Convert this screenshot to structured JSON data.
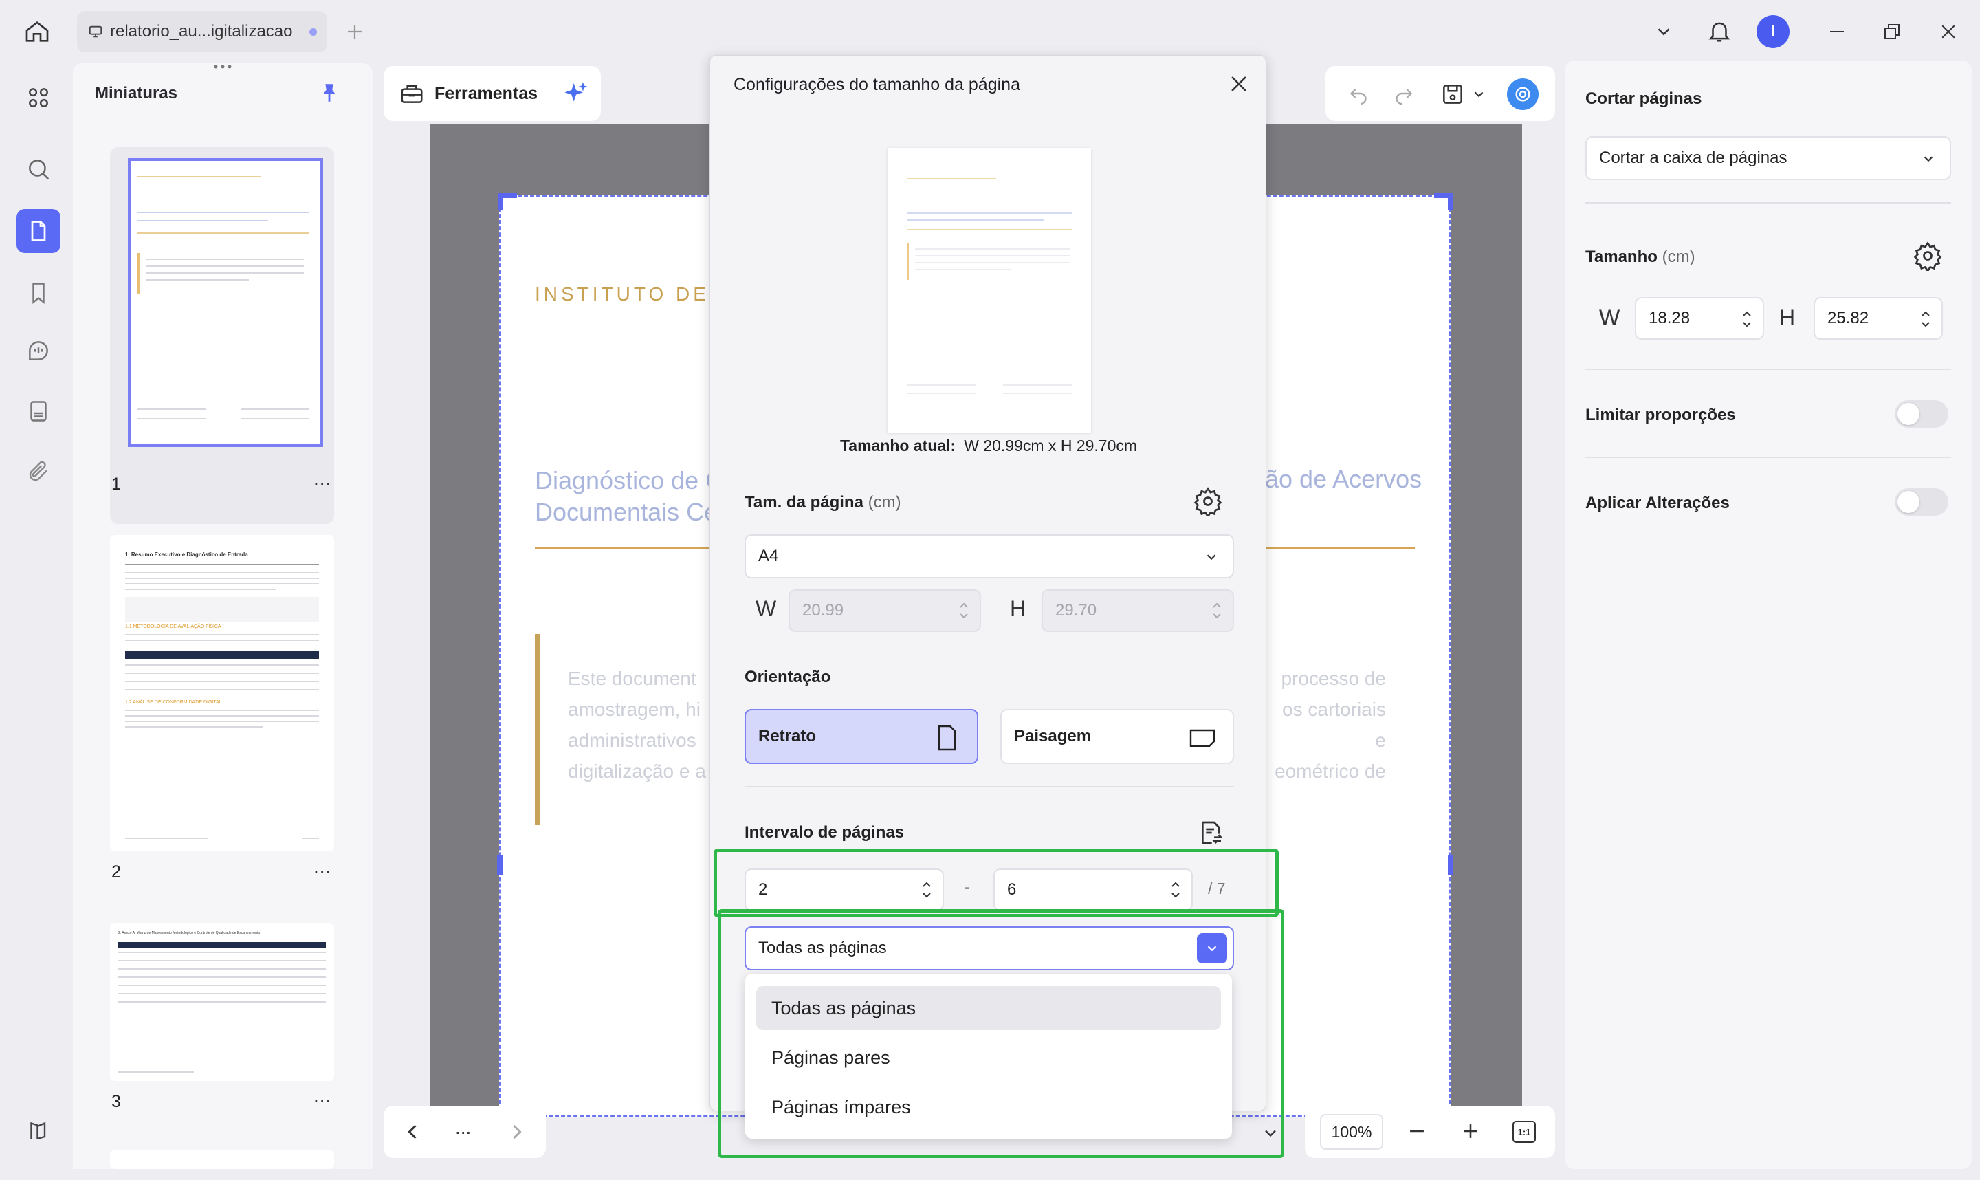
{
  "titlebar": {
    "tab_title": "relatorio_au...igitalizacao",
    "avatar_letter": "I"
  },
  "thumbnails": {
    "title": "Miniaturas",
    "pages": [
      "1",
      "2",
      "3"
    ],
    "more": "..."
  },
  "toolbar": {
    "tools_label": "Ferramentas"
  },
  "document": {
    "header": "INSTITUTO DE P",
    "title_left_1": "Diagnóstico de C",
    "title_left_2": "Documentais Ce",
    "title_right": "ão de Acervos",
    "body_left": [
      "Este document",
      "amostragem, hi",
      "administrativos",
      "digitalização e a"
    ],
    "body_right": [
      "processo de",
      "os cartoriais e",
      "eométrico de"
    ]
  },
  "thumb2": {
    "heading": "1. Resumo Executivo e Diagnóstico de Entrada",
    "section": "1.1 METODOLOGIA DE AVALIAÇÃO FÍSICA",
    "section2": "1.2 ANÁLISE DE CONFORMIDADE DIGITAL"
  },
  "thumb3": {
    "heading": "2. Anexo A: Matriz de Mapeamento Metodológico e Controle de Qualidade de Escaneamento"
  },
  "navbar": {
    "more": "..."
  },
  "zoom": {
    "value": "100%",
    "fit_label": "1:1"
  },
  "right_panel": {
    "crop_title": "Cortar páginas",
    "crop_option": "Cortar a caixa de páginas",
    "size_title": "Tamanho",
    "size_unit": "(cm)",
    "w_label": "W",
    "w_value": "18.28",
    "h_label": "H",
    "h_value": "25.82",
    "lock_label": "Limitar proporções",
    "apply_label": "Aplicar Alterações"
  },
  "dialog": {
    "title": "Configurações do tamanho da página",
    "current_size_label": "Tamanho atual:",
    "current_size_value": "W 20.99cm x H 29.70cm",
    "page_size_label": "Tam. da página",
    "page_size_unit": "(cm)",
    "page_size_value": "A4",
    "w_label": "W",
    "w_value": "20.99",
    "h_label": "H",
    "h_value": "29.70",
    "orientation_label": "Orientação",
    "portrait_label": "Retrato",
    "landscape_label": "Paisagem",
    "range_label": "Intervalo de páginas",
    "range_from": "2",
    "range_sep": "-",
    "range_to": "6",
    "range_total": "/ 7",
    "subset_value": "Todas as páginas",
    "subset_options": [
      "Todas as páginas",
      "Páginas pares",
      "Páginas ímpares"
    ]
  },
  "colors": {
    "accent": "#5b6af5",
    "highlight": "#2fb84a",
    "doc_gold": "#c8a050"
  }
}
